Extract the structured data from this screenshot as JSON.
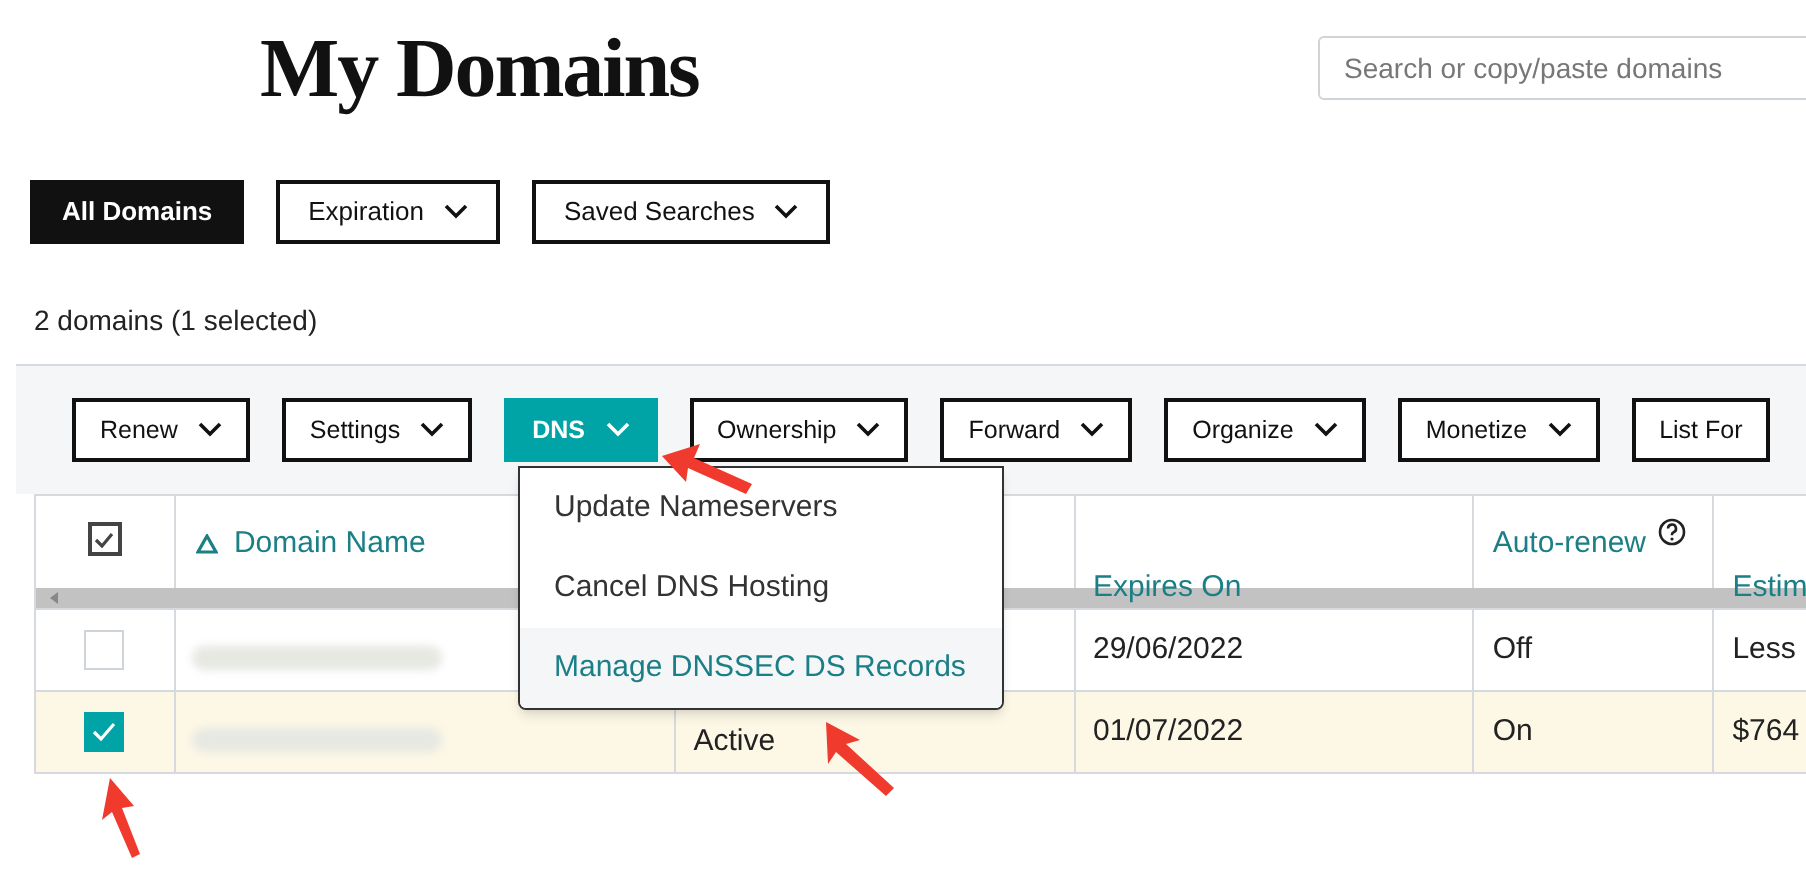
{
  "page": {
    "title": "My Domains"
  },
  "search": {
    "placeholder": "Search or copy/paste domains"
  },
  "filters": [
    {
      "label": "All Domains",
      "selected": true,
      "dropdown": false
    },
    {
      "label": "Expiration",
      "selected": false,
      "dropdown": true
    },
    {
      "label": "Saved Searches",
      "selected": false,
      "dropdown": true
    }
  ],
  "summary": "2 domains (1 selected)",
  "actions": [
    {
      "label": "Renew",
      "selected": false,
      "dropdown": true
    },
    {
      "label": "Settings",
      "selected": false,
      "dropdown": true
    },
    {
      "label": "DNS",
      "selected": true,
      "dropdown": true
    },
    {
      "label": "Ownership",
      "selected": false,
      "dropdown": true
    },
    {
      "label": "Forward",
      "selected": false,
      "dropdown": true
    },
    {
      "label": "Organize",
      "selected": false,
      "dropdown": true
    },
    {
      "label": "Monetize",
      "selected": false,
      "dropdown": true
    },
    {
      "label": "List For",
      "selected": false,
      "dropdown": false
    }
  ],
  "menu": {
    "items": [
      {
        "label": "Update Nameservers",
        "highlighted": false
      },
      {
        "label": "Cancel DNS Hosting",
        "highlighted": false
      },
      {
        "label": "Manage DNSSEC DS Records",
        "highlighted": true
      }
    ]
  },
  "table": {
    "all_checked": true,
    "domain_header": {
      "label": "Domain Name",
      "sorted": true
    },
    "expires_header": "Expires On",
    "auto_renew_header": "Auto-renew",
    "column_6_header": "Estim",
    "rows": [
      {
        "checked": false,
        "status": null,
        "expires": "29/06/2022",
        "auto_renew": "Off",
        "column_6": "Less"
      },
      {
        "checked": true,
        "status": "Active",
        "expires": "01/07/2022",
        "auto_renew": "On",
        "column_6": "$764"
      }
    ]
  }
}
